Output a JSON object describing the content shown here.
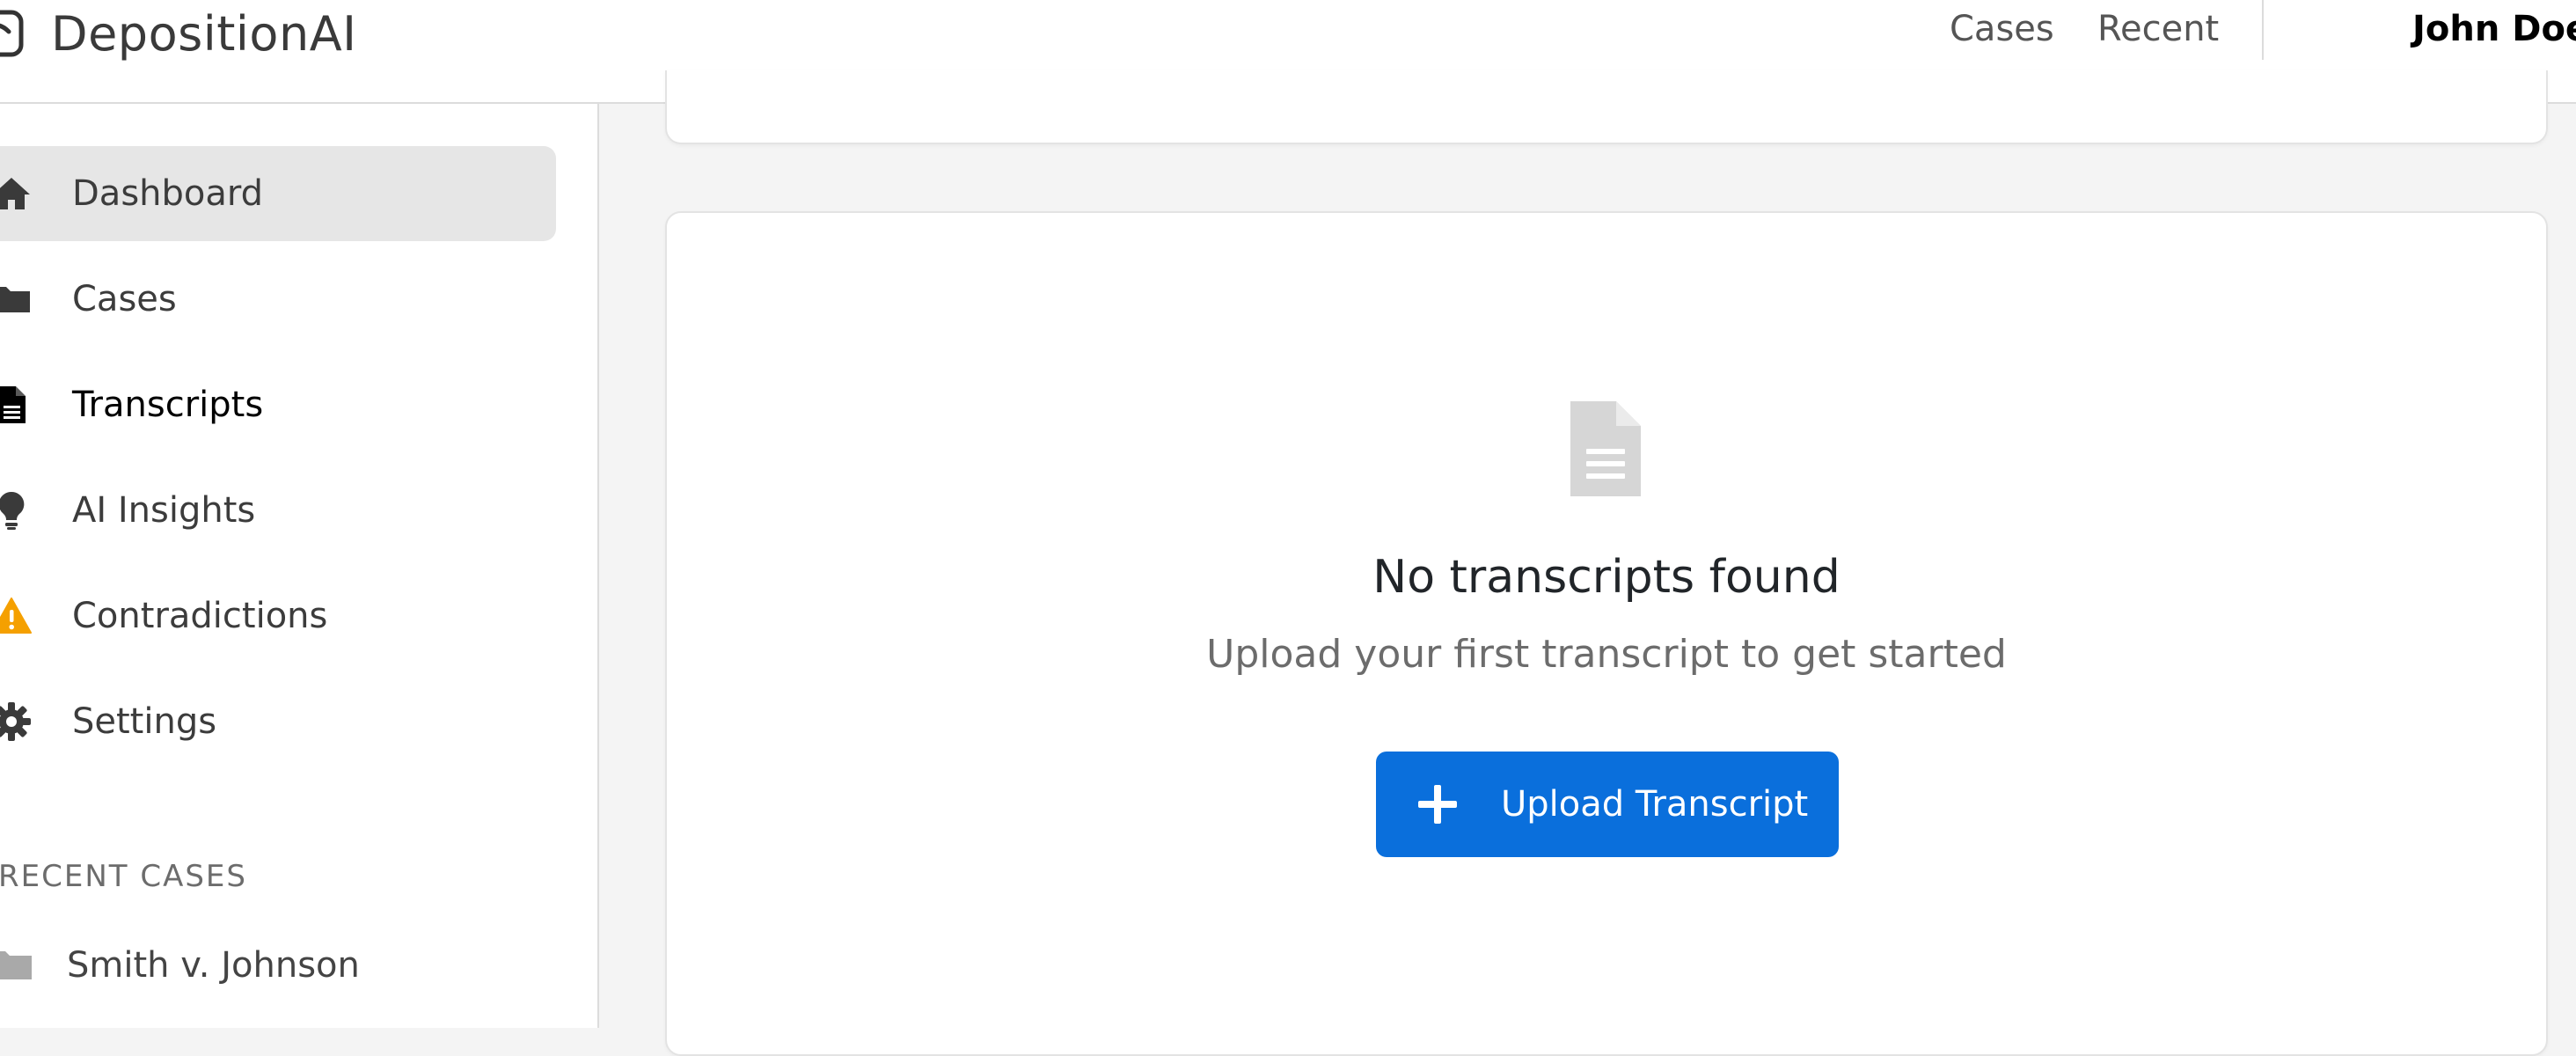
{
  "app": {
    "name": "DepositionAI"
  },
  "header": {
    "nav": [
      {
        "label": "Cases"
      },
      {
        "label": "Recent"
      }
    ],
    "user_name": "John Doe"
  },
  "sidebar": {
    "items": [
      {
        "label": "Dashboard",
        "icon": "home-icon"
      },
      {
        "label": "Cases",
        "icon": "folder-icon"
      },
      {
        "label": "Transcripts",
        "icon": "document-icon"
      },
      {
        "label": "AI Insights",
        "icon": "lightbulb-icon"
      },
      {
        "label": "Contradictions",
        "icon": "warning-icon"
      },
      {
        "label": "Settings",
        "icon": "gear-icon"
      }
    ],
    "active_index": 0,
    "current_index": 2,
    "recent_heading": "RECENT CASES",
    "recent_cases": [
      {
        "label": "Smith v. Johnson",
        "icon": "folder-icon"
      }
    ]
  },
  "main": {
    "empty_state": {
      "icon": "document-icon",
      "title": "No transcripts found",
      "subtitle": "Upload your first transcript to get started",
      "button_label": "Upload Transcript",
      "button_icon": "plus-icon"
    }
  },
  "colors": {
    "primary": "#0a6fdc",
    "warning": "#f5a000",
    "sidebar_active_bg": "#e6e6e6",
    "page_bg": "#f4f4f4"
  }
}
